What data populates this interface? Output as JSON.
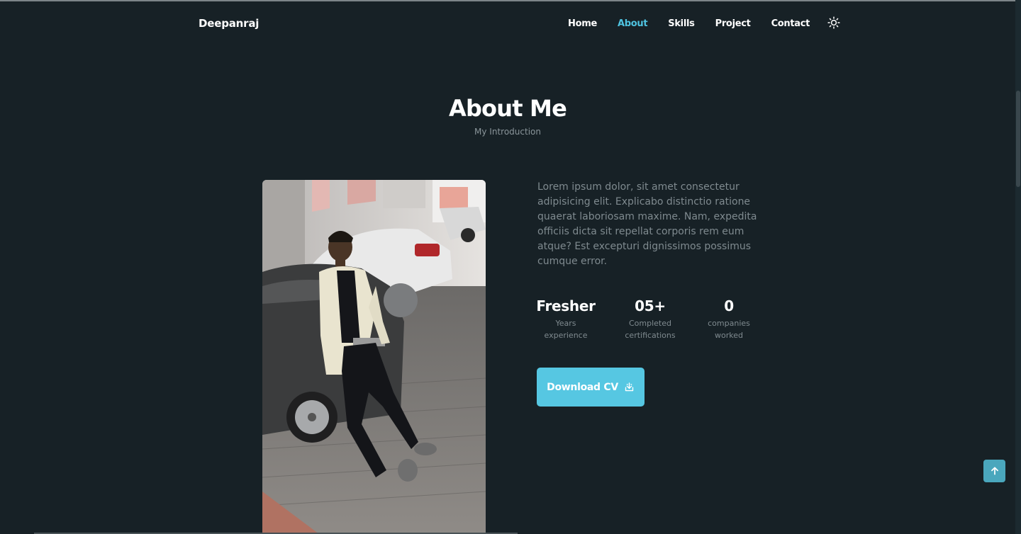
{
  "header": {
    "logo": "Deepanraj",
    "nav": [
      "Home",
      "About",
      "Skills",
      "Project",
      "Contact"
    ],
    "active": "About",
    "theme_icon": "sun-icon"
  },
  "about": {
    "title": "About Me",
    "subtitle": "My Introduction",
    "description": "Lorem ipsum dolor, sit amet consectetur adipisicing elit. Explicabo distinctio ratione quaerat laboriosam maxime. Nam, expedita officiis dicta sit repellat corporis rem eum atque? Est excepturi dignissimos possimus cumque error.",
    "stats": [
      {
        "value": "Fresher",
        "label_line1": "Years",
        "label_line2": "experience"
      },
      {
        "value": "05+",
        "label_line1": "Completed",
        "label_line2": "certifications"
      },
      {
        "value": "0",
        "label_line1": "companies",
        "label_line2": "worked"
      }
    ],
    "cv_button": "Download CV",
    "cv_icon": "download-icon"
  },
  "scroll_up_icon": "arrow-up-icon",
  "colors": {
    "background": "#172126",
    "accent": "#56c7e2",
    "text_muted": "#7f8a8f"
  }
}
